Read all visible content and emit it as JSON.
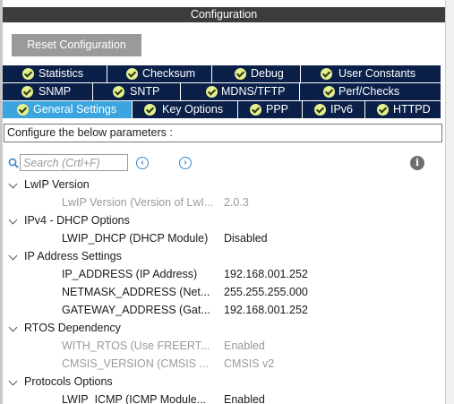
{
  "header": {
    "title": "Configuration"
  },
  "toolbar": {
    "reset_label": "Reset Configuration"
  },
  "tabs": {
    "row1": [
      {
        "label": "Statistics"
      },
      {
        "label": "Checksum"
      },
      {
        "label": "Debug"
      },
      {
        "label": "User Constants"
      }
    ],
    "row2": [
      {
        "label": "SNMP"
      },
      {
        "label": "SNTP"
      },
      {
        "label": "MDNS/TFTP"
      },
      {
        "label": "Perf/Checks"
      }
    ],
    "row3": [
      {
        "label": "General Settings",
        "active": true
      },
      {
        "label": "Key Options"
      },
      {
        "label": "PPP"
      },
      {
        "label": "IPv6"
      },
      {
        "label": "HTTPD"
      }
    ]
  },
  "description": {
    "text": "Configure the below parameters :"
  },
  "search": {
    "placeholder": "Search (Crtl+F)"
  },
  "tree": {
    "groups": [
      {
        "label": "LwIP Version",
        "params": [
          {
            "name": "LwIP Version (Version of LwI...",
            "value": "2.0.3",
            "enabled": false
          }
        ]
      },
      {
        "label": "IPv4 - DHCP Options",
        "params": [
          {
            "name": "LWIP_DHCP (DHCP Module)",
            "value": "Disabled",
            "enabled": true
          }
        ]
      },
      {
        "label": "IP Address Settings",
        "params": [
          {
            "name": "IP_ADDRESS (IP Address)",
            "value": "192.168.001.252",
            "enabled": true
          },
          {
            "name": "NETMASK_ADDRESS (Net...",
            "value": "255.255.255.000",
            "enabled": true
          },
          {
            "name": "GATEWAY_ADDRESS (Gat...",
            "value": "192.168.001.252",
            "enabled": true
          }
        ]
      },
      {
        "label": "RTOS Dependency",
        "params": [
          {
            "name": "WITH_RTOS (Use FREERT...",
            "value": "Enabled",
            "enabled": false
          },
          {
            "name": "CMSIS_VERSION (CMSIS ...",
            "value": "CMSIS v2",
            "enabled": false
          }
        ]
      },
      {
        "label": "Protocols Options",
        "params": [
          {
            "name": "LWIP_ICMP (ICMP Module...",
            "value": "Enabled",
            "enabled": true
          }
        ]
      }
    ]
  },
  "icons": {
    "tab_status": "check-circle-icon",
    "search": "search-icon",
    "prev": "chevron-left-circle-icon",
    "next": "chevron-right-circle-icon",
    "info": "info-icon",
    "group_toggle": "chevron-down-icon"
  },
  "colors": {
    "title_bar": "#3c3c3c",
    "tab_bg": "#0b2049",
    "tab_active": "#3aa5de",
    "check_fill": "#e6ef8e",
    "reset_button": "#9a9a9a",
    "disabled_text": "#9a9a9a"
  }
}
